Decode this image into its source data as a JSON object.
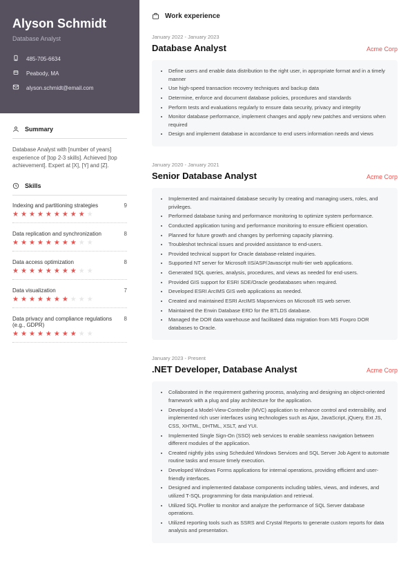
{
  "header": {
    "name": "Alyson Schmidt",
    "role": "Database Analyst"
  },
  "contacts": [
    {
      "icon": "phone",
      "text": "485-705-6634"
    },
    {
      "icon": "location",
      "text": "Peabody, MA"
    },
    {
      "icon": "email",
      "text": "alyson.schmidt@email.com"
    }
  ],
  "summary": {
    "heading": "Summary",
    "text": "Database Analyst with [number of years] experience of [top 2-3 skills]. Achieved [top achievement]. Expert at [X], [Y] and [Z]."
  },
  "skills": {
    "heading": "Skills",
    "items": [
      {
        "name": "Indexing and partitioning strategies",
        "score": 9
      },
      {
        "name": "Data replication and synchronization",
        "score": 8
      },
      {
        "name": "Data access optimization",
        "score": 8
      },
      {
        "name": "Data visualization",
        "score": 7
      },
      {
        "name": "Data privacy and compliance regulations (e.g., GDPR)",
        "score": 8
      }
    ]
  },
  "work": {
    "heading": "Work experience",
    "jobs": [
      {
        "dates": "January 2022 - January 2023",
        "title": "Database Analyst",
        "company": "Acme Corp",
        "bullets": [
          "Define users and enable data distribution to the right user, in appropriate format and in a timely manner",
          "Use high-speed transaction recovery techniques and backup data",
          "Determine, enforce and document database policies, procedures and standards",
          "Perform tests and evaluations regularly to ensure data security, privacy and integrity",
          "Monitor database performance, implement changes and apply new patches and versions when required",
          "Design and implement database in accordance to end users information needs and views"
        ]
      },
      {
        "dates": "January 2020 - January 2021",
        "title": "Senior Database Analyst",
        "company": "Acme Corp",
        "bullets": [
          "Implemented and maintained database security by creating and managing users, roles, and privileges.",
          "Performed database tuning and performance monitoring to optimize system performance.",
          "Conducted application tuning and performance monitoring to ensure efficient operation.",
          "Planned for future growth and changes by performing capacity planning.",
          "Troubleshot technical issues and provided assistance to end-users.",
          "Provided technical support for Oracle database-related inquiries.",
          "Supported NT server for Microsoft IIS/ASP/Javascript multi-tier web applications.",
          "Generated SQL queries, analysis, procedures, and views as needed for end-users.",
          "Provided GIS support for ESRI SDE/Oracle geodatabases when required.",
          "Developed ESRI ArcIMS GIS web applications as needed.",
          "Created and maintained ESRI ArcIMS Mapservices on Microsoft IIS web server.",
          "Maintained the Erwin Database ERD for the BTLDS database.",
          "Managed the DOR data warehouse and facilitated data migration from MS Foxpro DOR databases to Oracle."
        ]
      },
      {
        "dates": "January 2023 - Present",
        "title": ".NET Developer, Database Analyst",
        "company": "Acme Corp",
        "bullets": [
          "Collaborated in the requirement gathering process, analyzing and designing an object-oriented framework with a plug and play architecture for the application.",
          "Developed a Model-View-Controller (MVC) application to enhance control and extensibility, and implemented rich user interfaces using technologies such as Ajax, JavaScript, jQuery, Ext JS, CSS, XHTML, DHTML, XSLT, and YUI.",
          "Implemented Single Sign-On (SSO) web services to enable seamless navigation between different modules of the application.",
          "Created nightly jobs using Scheduled Windows Services and SQL Server Job Agent to automate routine tasks and ensure timely execution.",
          "Developed Windows Forms applications for internal operations, providing efficient and user-friendly interfaces.",
          "Designed and implemented database components including tables, views, and indexes, and utilized T-SQL programming for data manipulation and retrieval.",
          "Utilized SQL Profiler to monitor and analyze the performance of SQL Server database operations.",
          "Utilized reporting tools such as SSRS and Crystal Reports to generate custom reports for data analysis and presentation."
        ]
      }
    ]
  }
}
